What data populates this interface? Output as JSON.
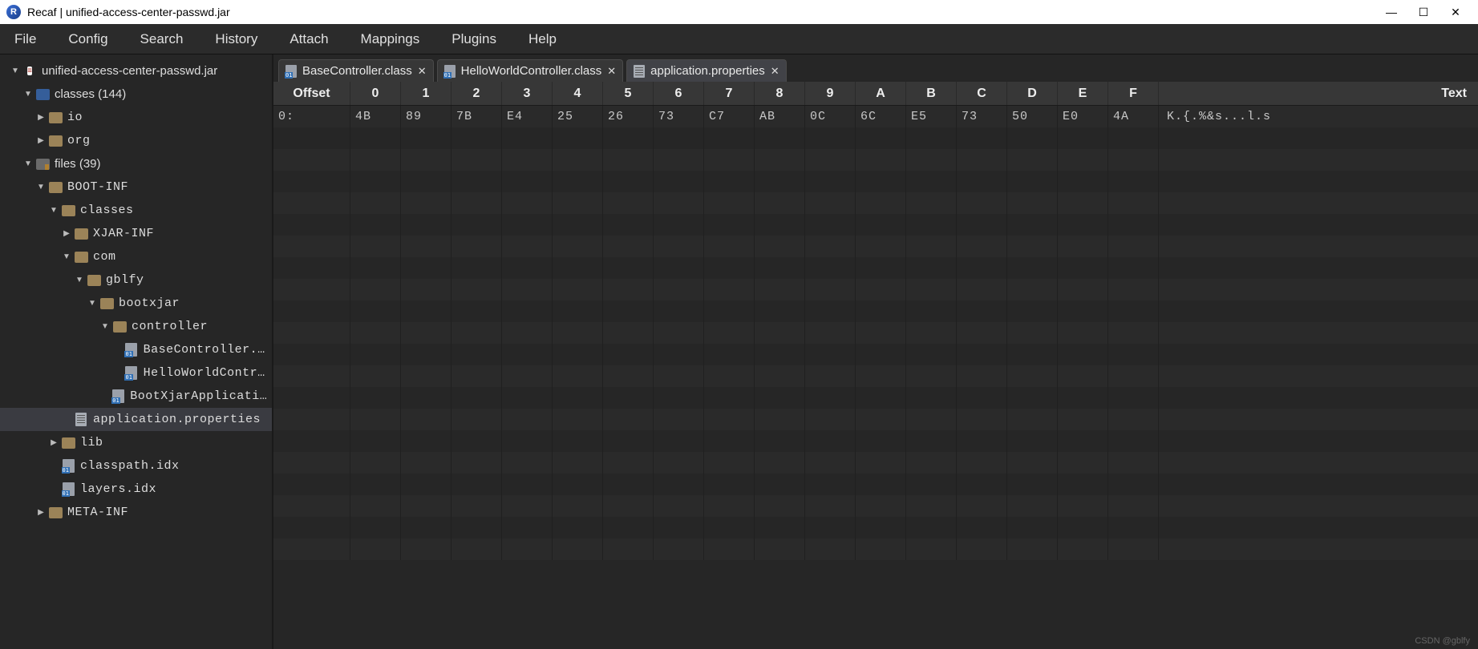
{
  "window": {
    "title": "Recaf | unified-access-center-passwd.jar",
    "app_icon_letter": "R"
  },
  "menu": [
    "File",
    "Config",
    "Search",
    "History",
    "Attach",
    "Mappings",
    "Plugins",
    "Help"
  ],
  "tree": [
    {
      "indent": 0,
      "arrow": "▼",
      "iconClass": "icon-jar",
      "iconText": "",
      "label": "unified-access-center-passwd.jar",
      "mono": false,
      "selected": false
    },
    {
      "indent": 1,
      "arrow": "▼",
      "iconClass": "icon-folder-blue",
      "iconText": "",
      "label": "classes (144)",
      "mono": false,
      "selected": false
    },
    {
      "indent": 2,
      "arrow": "▶",
      "iconClass": "icon-folder-tan",
      "iconText": "",
      "label": "io",
      "mono": true,
      "selected": false
    },
    {
      "indent": 2,
      "arrow": "▶",
      "iconClass": "icon-folder-tan",
      "iconText": "",
      "label": "org",
      "mono": true,
      "selected": false
    },
    {
      "indent": 1,
      "arrow": "▼",
      "iconClass": "icon-folder-grey",
      "iconText": "",
      "label": "files (39)",
      "mono": false,
      "selected": false
    },
    {
      "indent": 2,
      "arrow": "▼",
      "iconClass": "icon-folder-tan",
      "iconText": "",
      "label": "BOOT-INF",
      "mono": true,
      "selected": false
    },
    {
      "indent": 3,
      "arrow": "▼",
      "iconClass": "icon-folder-tan",
      "iconText": "",
      "label": "classes",
      "mono": true,
      "selected": false
    },
    {
      "indent": 4,
      "arrow": "▶",
      "iconClass": "icon-folder-tan",
      "iconText": "",
      "label": "XJAR-INF",
      "mono": true,
      "selected": false
    },
    {
      "indent": 4,
      "arrow": "▼",
      "iconClass": "icon-folder-tan",
      "iconText": "",
      "label": "com",
      "mono": true,
      "selected": false
    },
    {
      "indent": 5,
      "arrow": "▼",
      "iconClass": "icon-folder-tan",
      "iconText": "",
      "label": "gblfy",
      "mono": true,
      "selected": false
    },
    {
      "indent": 6,
      "arrow": "▼",
      "iconClass": "icon-folder-tan",
      "iconText": "",
      "label": "bootxjar",
      "mono": true,
      "selected": false
    },
    {
      "indent": 7,
      "arrow": "▼",
      "iconClass": "icon-folder-tan",
      "iconText": "",
      "label": "controller",
      "mono": true,
      "selected": false
    },
    {
      "indent": 8,
      "arrow": "",
      "iconClass": "icon-file-bin",
      "iconText": "",
      "label": "BaseController.cl",
      "mono": true,
      "selected": false
    },
    {
      "indent": 8,
      "arrow": "",
      "iconClass": "icon-file-bin",
      "iconText": "",
      "label": "HelloWorldControl",
      "mono": true,
      "selected": false
    },
    {
      "indent": 7,
      "arrow": "",
      "iconClass": "icon-file-bin",
      "iconText": "",
      "label": "BootXjarApplication",
      "mono": true,
      "selected": false
    },
    {
      "indent": 4,
      "arrow": "",
      "iconClass": "icon-file-plain",
      "iconText": "",
      "label": "application.properties",
      "mono": true,
      "selected": true
    },
    {
      "indent": 3,
      "arrow": "▶",
      "iconClass": "icon-folder-tan",
      "iconText": "",
      "label": "lib",
      "mono": true,
      "selected": false
    },
    {
      "indent": 3,
      "arrow": "",
      "iconClass": "icon-file-bin",
      "iconText": "",
      "label": "classpath.idx",
      "mono": true,
      "selected": false
    },
    {
      "indent": 3,
      "arrow": "",
      "iconClass": "icon-file-bin",
      "iconText": "",
      "label": "layers.idx",
      "mono": true,
      "selected": false
    },
    {
      "indent": 2,
      "arrow": "▶",
      "iconClass": "icon-folder-tan",
      "iconText": "",
      "label": "META-INF",
      "mono": true,
      "selected": false
    }
  ],
  "tabs": [
    {
      "label": "BaseController.class",
      "iconClass": "icon-file-bin",
      "active": false
    },
    {
      "label": "HelloWorldController.class",
      "iconClass": "icon-file-bin",
      "active": false
    },
    {
      "label": "application.properties",
      "iconClass": "icon-file-plain",
      "active": true
    }
  ],
  "hex": {
    "header": [
      "Offset",
      "0",
      "1",
      "2",
      "3",
      "4",
      "5",
      "6",
      "7",
      "8",
      "9",
      "A",
      "B",
      "C",
      "D",
      "E",
      "F",
      "Text"
    ],
    "rows": [
      {
        "offset": "0:",
        "bytes": [
          "4B",
          "89",
          "7B",
          "E4",
          "25",
          "26",
          "73",
          "C7",
          "AB",
          "0C",
          "6C",
          "E5",
          "73",
          "50",
          "E0",
          "4A"
        ],
        "text": "K.{.%&s...l.s"
      }
    ],
    "emptyRows": 20
  },
  "watermark": "CSDN @gblfy"
}
